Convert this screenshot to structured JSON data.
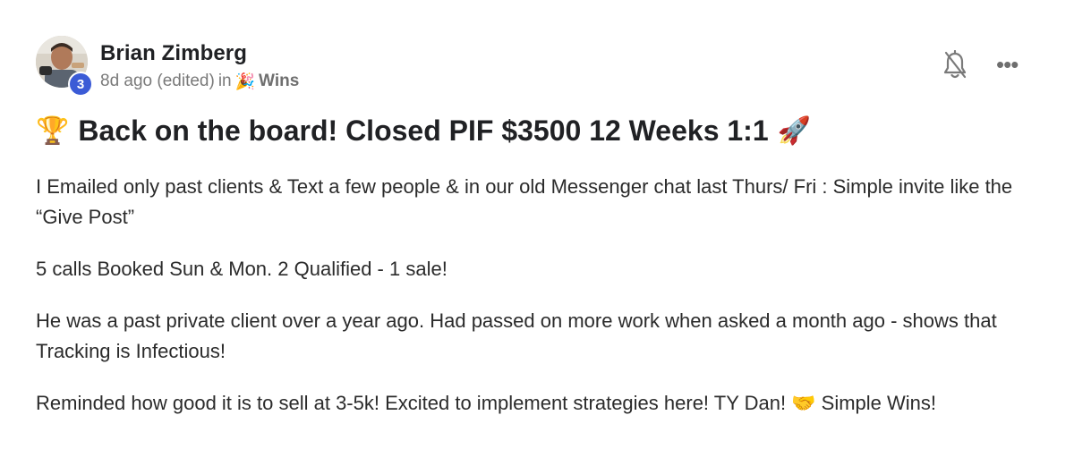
{
  "author": {
    "name": "Brian Zimberg",
    "level": "3"
  },
  "meta": {
    "time": "8d ago (edited)",
    "in_word": "in",
    "category_emoji": "🎉",
    "category": "Wins"
  },
  "actions": {
    "bell_icon": "bell-off-icon",
    "more_icon": "more-horizontal-icon",
    "more_glyph": "•••"
  },
  "post": {
    "title_emoji": "🏆",
    "title": "Back on the board! Closed PIF $3500 12 Weeks 1:1",
    "title_emoji_after": "🚀",
    "paragraphs": [
      "I Emailed only past clients & Text a few people & in our old Messenger chat last Thurs/ Fri : Simple invite like the “Give Post”",
      "5 calls Booked Sun & Mon. 2 Qualified - 1 sale!",
      "He was a past private client over a year ago. Had passed on more work when asked a month ago - shows that Tracking is Infectious!",
      "Reminded how good it is to sell at 3-5k! Excited to implement strategies here! TY Dan! 🤝 Simple Wins!"
    ]
  },
  "colors": {
    "badge": "#3b5bd6",
    "text": "#202124",
    "muted": "#7a7a7a"
  }
}
